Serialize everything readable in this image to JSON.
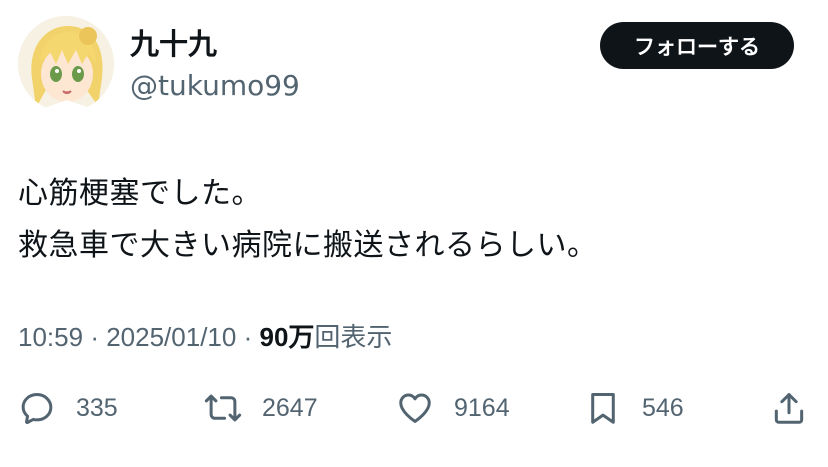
{
  "user": {
    "display_name": "九十九",
    "handle": "@tukumo99"
  },
  "follow_button": {
    "label": "フォローする"
  },
  "tweet": {
    "lines": [
      "心筋梗塞でした。",
      "救急車で大きい病院に搬送されるらしい。"
    ]
  },
  "meta": {
    "time": "10:59",
    "separator": "·",
    "date": "2025/01/10",
    "views_count": "90万",
    "views_label": "回表示"
  },
  "actions": {
    "reply": {
      "icon": "reply-icon",
      "count": "335"
    },
    "retweet": {
      "icon": "retweet-icon",
      "count": "2647"
    },
    "like": {
      "icon": "heart-icon",
      "count": "9164"
    },
    "bookmark": {
      "icon": "bookmark-icon",
      "count": "546"
    },
    "share": {
      "icon": "share-icon"
    }
  },
  "colors": {
    "text_primary": "#0f1419",
    "text_secondary": "#536471",
    "button_bg": "#0f1419",
    "button_text": "#ffffff"
  }
}
